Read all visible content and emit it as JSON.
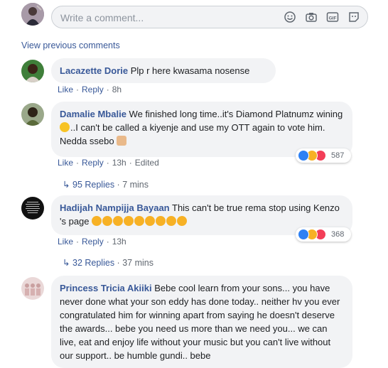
{
  "composer": {
    "placeholder": "Write a comment..."
  },
  "view_previous": "View previous comments",
  "actions": {
    "like": "Like",
    "reply": "Reply"
  },
  "comments": [
    {
      "author": "Lacazette Dorie",
      "text": " Plp r here kwasama nosense",
      "time": "8h"
    },
    {
      "author": "Damalie Mbalie",
      "text1": " We finished long time..it's Diamond Platnumz wining ",
      "text2": "..I can't be called a kiyenje and use my OTT again to vote him. Nedda ssebo ",
      "time": "13h",
      "edited": "Edited",
      "reaction_count": "587",
      "replies_label": "95 Replies",
      "replies_time": "7 mins"
    },
    {
      "author": "Hadijah Nampijja Bayaan",
      "text": " This can't be true rema stop using Kenzo 's page",
      "time": "13h",
      "reaction_count": "368",
      "replies_label": "32 Replies",
      "replies_time": "37 mins"
    },
    {
      "author": "Princess Tricia Akiiki",
      "text": " Bebe cool learn from your sons... you have never done what your son eddy has done today.. neither hv you ever congratulated him for winning apart from saying he doesn't deserve the awards... bebe you need us more than we need you... we can live, eat and enjoy life without your music but you can't live without our support.. be humble gundi.. bebe"
    }
  ],
  "colors": {
    "link": "#385898",
    "bubble": "#f2f3f5",
    "meta": "#606770"
  }
}
